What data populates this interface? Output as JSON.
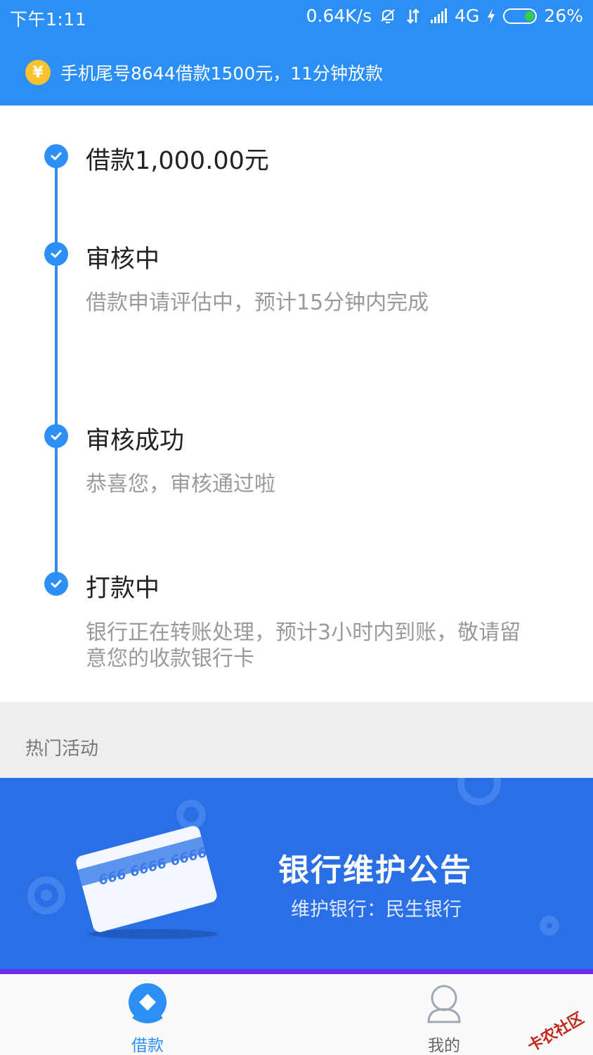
{
  "status_bar": {
    "time": "下午1:11",
    "network_speed": "0.64K/s",
    "network_type": "4G",
    "battery": "26%"
  },
  "banner": {
    "icon": "yen-coin-icon",
    "text": "手机尾号8644借款1500元，11分钟放款"
  },
  "steps": [
    {
      "title": "借款1,000.00元",
      "desc": ""
    },
    {
      "title": "审核中",
      "desc": "借款申请评估中，预计15分钟内完成"
    },
    {
      "title": "审核成功",
      "desc": "恭喜您，审核通过啦"
    },
    {
      "title": "打款中",
      "desc": "银行正在转账处理，预计3小时内到账，敬请留意您的收款银行卡"
    }
  ],
  "hot": {
    "title": "热门活动",
    "promo_title": "银行维护公告",
    "promo_sub": "维护银行：民生银行",
    "card_number": "666 6666 6666"
  },
  "nav": {
    "loan_label": "借款",
    "mine_label": "我的"
  },
  "watermark": "卡农社区",
  "colors": {
    "primary": "#2b8ff5",
    "promo_bg": "#2a6fe6",
    "coin": "#f9c22e"
  }
}
